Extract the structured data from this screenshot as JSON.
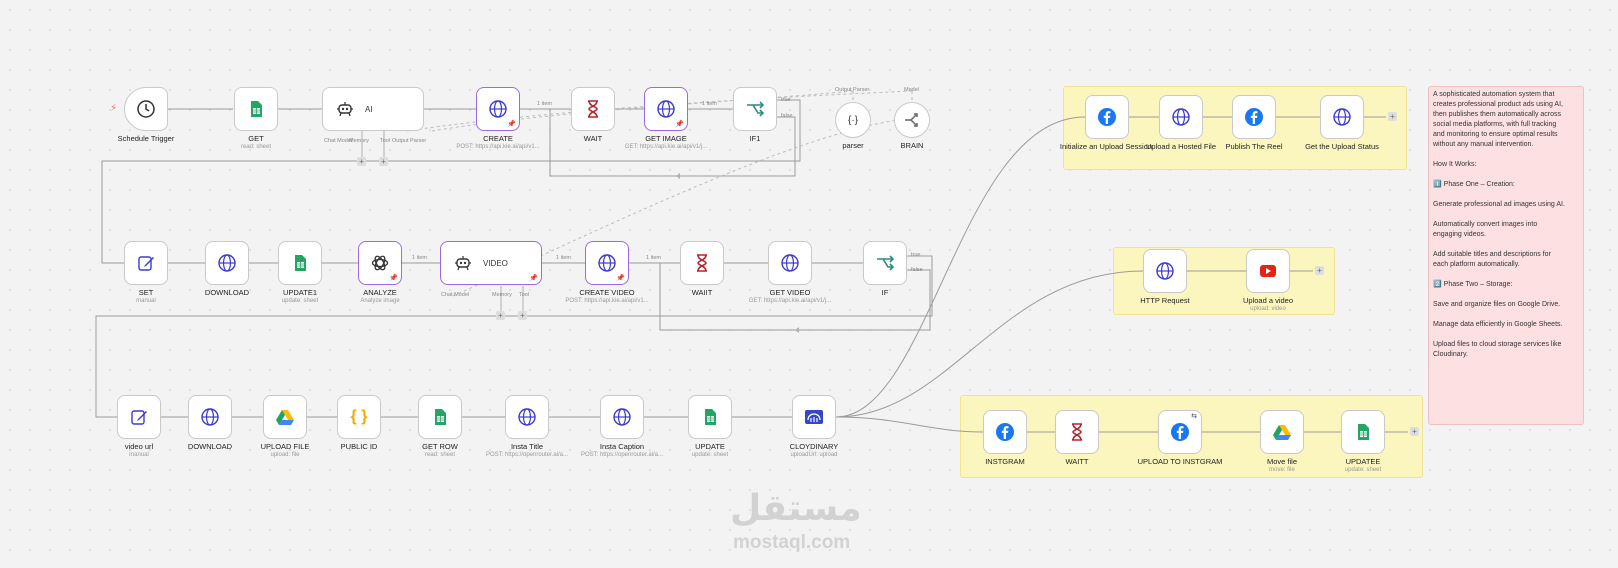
{
  "nodes": {
    "schedule_trigger": {
      "label": "Schedule Trigger"
    },
    "get": {
      "label": "GET",
      "sub": "read: sheet"
    },
    "ai": {
      "label": "AI",
      "ports": [
        "Chat Model",
        "Memory",
        "Tool",
        "Output Parser"
      ]
    },
    "create": {
      "label": "CREATE",
      "sub": "POST: https://api.kie.ai/api/v1..."
    },
    "wait": {
      "label": "WAIT"
    },
    "get_image": {
      "label": "GET IMAGE",
      "sub": "GET: https://api.kie.ai/api/v1/j..."
    },
    "if1": {
      "label": "IF1"
    },
    "parser": {
      "label": "parser"
    },
    "brain": {
      "label": "BRAIN"
    },
    "set": {
      "label": "SET",
      "sub": "manual"
    },
    "download": {
      "label": "DOWNLOAD"
    },
    "update1": {
      "label": "UPDATE1",
      "sub": "update: sheet"
    },
    "analyze": {
      "label": "ANALYZE",
      "sub": "Analyze image"
    },
    "video": {
      "label": "VIDEO",
      "ports": [
        "Chat Model",
        "Memory",
        "Tool"
      ]
    },
    "create_video": {
      "label": "CREATE VIDEO",
      "sub": "POST: https://api.kie.ai/api/v1..."
    },
    "waiit": {
      "label": "WAIIT"
    },
    "get_video": {
      "label": "GET VIDEO",
      "sub": "GET: https://api.kie.ai/api/v1/j..."
    },
    "if": {
      "label": "IF"
    },
    "video_url": {
      "label": "video url",
      "sub": "manual"
    },
    "download2": {
      "label": "DOWNLOAD"
    },
    "upload_file": {
      "label": "UPLOAD FILE",
      "sub": "upload: file"
    },
    "public_id": {
      "label": "PUBLIC ID"
    },
    "get_row": {
      "label": "GET ROW",
      "sub": "read: sheet"
    },
    "insta_title": {
      "label": "Insta Title",
      "sub": "POST: https://openrouter.ai/a..."
    },
    "insta_caption": {
      "label": "Insta Caption",
      "sub": "POST: https://openrouter.ai/a..."
    },
    "update": {
      "label": "UPDATE",
      "sub": "update: sheet"
    },
    "cloudinary": {
      "label": "CLOYDINARY",
      "sub": "uploadUrl: upload"
    },
    "init_upload": {
      "label": "Initialize an Upload Session"
    },
    "upload_hosted": {
      "label": "Upload a Hosted File"
    },
    "publish_reel": {
      "label": "Publish The Reel"
    },
    "get_upload_status": {
      "label": "Get the Upload Status"
    },
    "http_request": {
      "label": "HTTP Request"
    },
    "upload_video": {
      "label": "Upload a video",
      "sub": "upload: video"
    },
    "instgram": {
      "label": "INSTGRAM"
    },
    "waitt": {
      "label": "WAITT"
    },
    "upload_instgram": {
      "label": "UPLOAD TO INSTGRAM"
    },
    "move_file": {
      "label": "Move file",
      "sub": "move: file"
    },
    "updatee": {
      "label": "UPDATEE",
      "sub": "update: sheet"
    }
  },
  "edge_labels": {
    "one_item": "1 item",
    "true": "true",
    "false": "false",
    "output_parser": "Output Parser",
    "model": "Model"
  },
  "sticky_note": "A sophisticated automation system that creates professional product ads using AI, then publishes them automatically across social media platforms, with full tracking and monitoring to ensure optimal results without any manual intervention.\n\nHow It Works:\n\n1️⃣ Phase One – Creation:\n\nGenerate professional ad images using AI.\n\nAutomatically convert images into engaging videos.\n\nAdd suitable titles and descriptions for each platform automatically.\n\n2️⃣ Phase Two – Storage:\n\nSave and organize files on Google Drive.\n\nManage data efficiently in Google Sheets.\n\nUpload files to cloud storage services like Cloudinary.",
  "watermark": {
    "arabic": "مستقل",
    "latin": "mostaql.com"
  },
  "colors": {
    "ai_border": "#9c6ade",
    "sheets_green": "#23a566",
    "facebook_blue": "#1877f2",
    "wait_red": "#b3262e",
    "if_green": "#2a8c7a",
    "youtube_red": "#e62117",
    "sticky_yellow": "#fbf6bd",
    "sticky_pink": "#fde1e2"
  }
}
